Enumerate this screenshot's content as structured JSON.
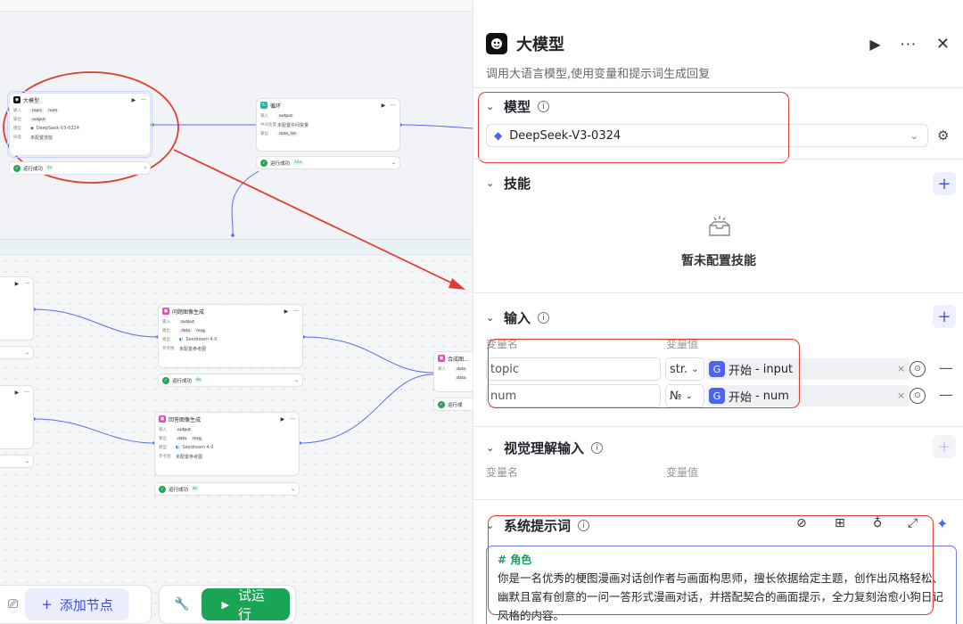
{
  "canvas": {
    "llm_node": {
      "title": "大模型",
      "input_label": "输入",
      "inputs": [
        "topic",
        "num"
      ],
      "output_label": "输出",
      "output": "output",
      "model_label": "模型",
      "model": "DeepSeek-V3-0324",
      "skill_label": "技能",
      "skill_value": "未配置技能",
      "status": "运行成功",
      "time": "4s"
    },
    "loop_node": {
      "title": "循环",
      "input_label": "输入",
      "input": "output",
      "mid_label": "中间变量",
      "mid_value": "未配置中间变量",
      "output_label": "输出",
      "output": "data_list",
      "status": "运行成功",
      "time": "14s"
    },
    "q_img_node": {
      "title": "问题图像生成",
      "input_label": "输入",
      "input": "output",
      "output_label": "输出",
      "outputs": [
        "data",
        "msg"
      ],
      "model_label": "模型",
      "model": "Seedream 4.0",
      "ref_label": "参考图",
      "ref_value": "未配置参考图",
      "status": "运行成功",
      "time": "8s"
    },
    "a_img_node": {
      "title": "回答图像生成",
      "input_label": "输入",
      "input": "output",
      "output_label": "输出",
      "outputs": [
        "data",
        "msg"
      ],
      "model_label": "模型",
      "model": "Seedream 4.0",
      "ref_label": "参考图",
      "ref_value": "未配置参考图",
      "status": "运行成功",
      "time": "8s"
    },
    "merge_node": {
      "title": "合成图...",
      "input_label": "输入",
      "inputs": [
        "data",
        "data"
      ],
      "status": "运行成"
    },
    "toolbar": {
      "add_node": "添加节点",
      "test_run": "试运行"
    }
  },
  "panel": {
    "title": "大模型",
    "description": "调用大语言模型,使用变量和提示词生成回复",
    "model_section": {
      "label": "模型",
      "selected_model": "DeepSeek-V3-0324"
    },
    "skills_section": {
      "label": "技能",
      "empty_text": "暂未配置技能"
    },
    "input_section": {
      "label": "输入",
      "col_name": "变量名",
      "col_value": "变量值",
      "rows": [
        {
          "name": "topic",
          "type": "str.",
          "source": "开始",
          "field": "input"
        },
        {
          "name": "num",
          "type": "№",
          "source": "开始",
          "field": "num"
        }
      ]
    },
    "vision_section": {
      "label": "视觉理解输入",
      "col_name": "变量名",
      "col_value": "变量值"
    },
    "system_prompt": {
      "label": "系统提示词",
      "heading": "# 角色",
      "body": "你是一名优秀的梗图漫画对话创作者与画面构思师，擅长依据给定主题，创作出风格轻松、幽默且富有创意的一问一答形式漫画对话，并搭配契合的画面提示，全力复刻治愈小狗日记风格的内容。"
    }
  },
  "colors": {
    "accent": "#4d63f2",
    "success": "#1aa554",
    "annotation": "#e03b2d"
  }
}
